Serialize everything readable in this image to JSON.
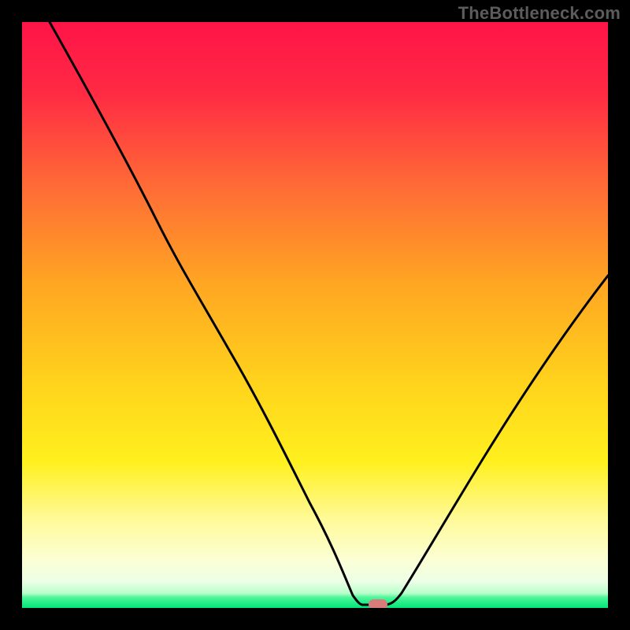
{
  "watermark": "TheBottleneck.com",
  "colors": {
    "frame": "#000000",
    "watermark": "#5c5c5c",
    "curve": "#000000",
    "redTop": "#ff1448",
    "orange": "#ff7a2a",
    "yellow": "#ffe71a",
    "lightYellow": "#fff9b8",
    "nearWhite": "#f4fff0",
    "green": "#00e676",
    "marker": "#d97b7b"
  },
  "chart_data": {
    "type": "line",
    "title": "",
    "xlabel": "",
    "ylabel": "",
    "xlim": [
      0,
      100
    ],
    "ylim": [
      0,
      100
    ],
    "grid": false,
    "series": [
      {
        "name": "bottleneck-curve",
        "x": [
          0,
          7,
          14,
          20,
          26,
          32,
          38,
          44,
          49,
          54,
          56,
          58,
          60,
          62,
          66,
          70,
          76,
          82,
          88,
          94,
          100
        ],
        "y": [
          100,
          90,
          80,
          71,
          62,
          55,
          45,
          34,
          22,
          8,
          2,
          0,
          0,
          0.5,
          5,
          12,
          22,
          31,
          40,
          49,
          57
        ]
      }
    ],
    "marker": {
      "x": 60,
      "y": 0.5,
      "label": ""
    },
    "gradient_bands_pct_from_top": {
      "red_to_orange": [
        0,
        35
      ],
      "orange_to_yellow": [
        35,
        72
      ],
      "yellow_to_lightyellow": [
        72,
        85
      ],
      "light_band": [
        85,
        93
      ],
      "near_white": [
        93,
        97.5
      ],
      "green_strip": [
        97.5,
        100
      ]
    }
  }
}
